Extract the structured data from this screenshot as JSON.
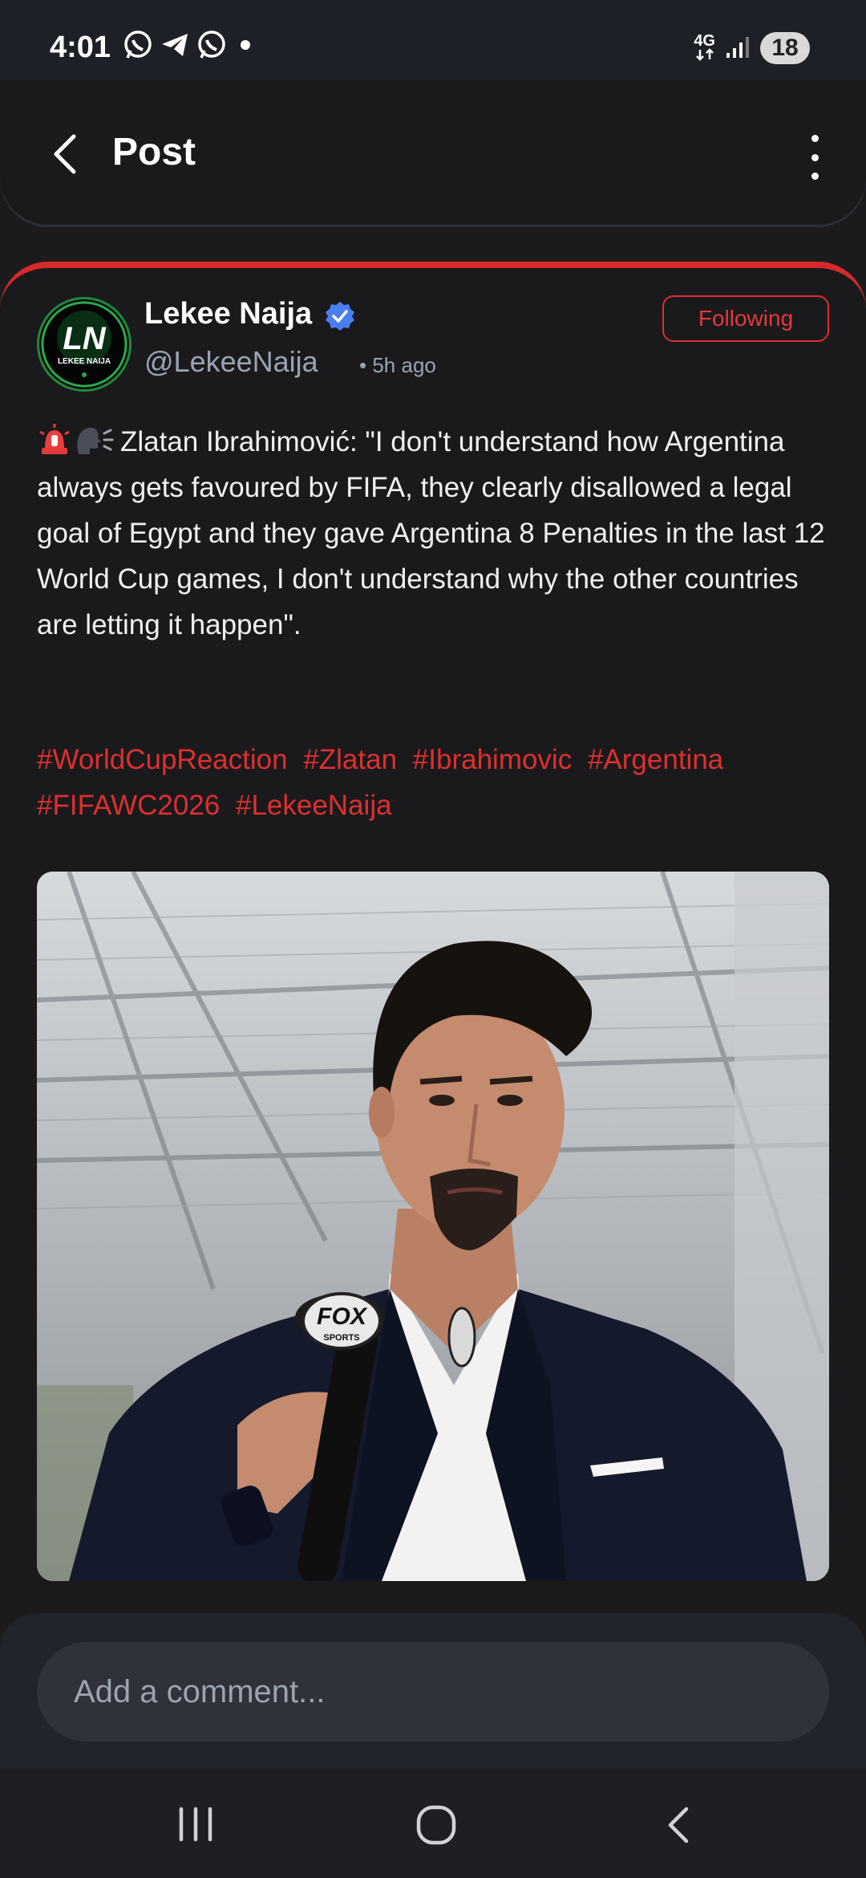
{
  "status_bar": {
    "time": "4:01",
    "network": "4G",
    "battery": "18"
  },
  "header": {
    "title": "Post"
  },
  "post": {
    "author_name": "Lekee Naija",
    "avatar_text": "LN",
    "avatar_subtext": "LEKEE NAIJA",
    "handle": "@LekeeNaija",
    "separator": "•",
    "time_ago": "5h ago",
    "follow_label": "Following",
    "text": "Zlatan Ibrahimović: \"I don't understand how Argentina always gets favoured by FIFA, they clearly disallowed a legal goal of Egypt and they gave Argentina 8 Penalties in the last 12 World Cup games, I don't understand why the other countries are letting it happen\".",
    "hashtags": [
      "#WorldCupReaction",
      "#Zlatan",
      "#Ibrahimovic",
      "#Argentina",
      "#FIFAWC2026",
      "#LekeeNaija"
    ],
    "image": {
      "mic_label_top": "FOX",
      "mic_label_bottom": "SPORTS"
    }
  },
  "comment": {
    "placeholder": "Add a comment..."
  },
  "colors": {
    "accent_red": "#de2f2f",
    "verified_blue": "#4a7ef0",
    "background": "#1a1a1c"
  }
}
